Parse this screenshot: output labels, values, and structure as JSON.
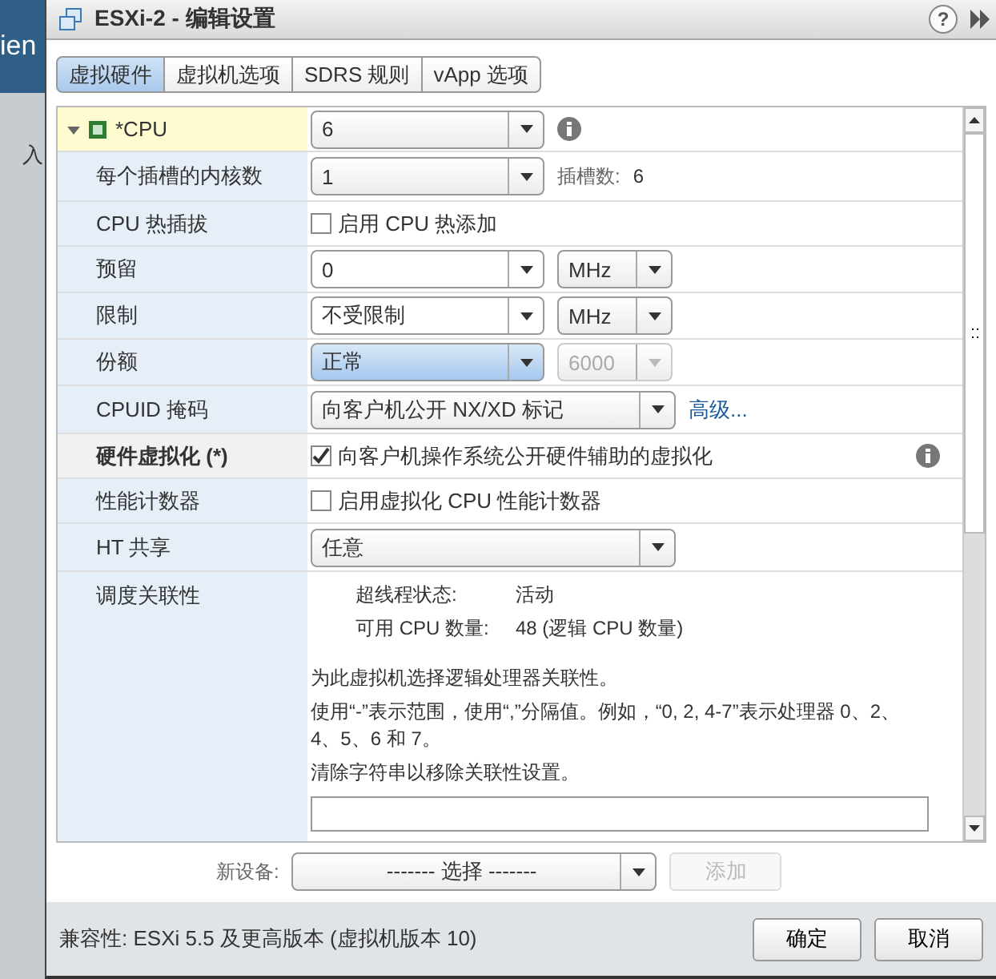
{
  "background_app": {
    "title_fragment": "ien",
    "tab_fragment": "入"
  },
  "window": {
    "title": "ESXi-2 - 编辑设置",
    "help": "?"
  },
  "tabs": [
    {
      "label": "虚拟硬件",
      "selected": true
    },
    {
      "label": "虚拟机选项",
      "selected": false
    },
    {
      "label": "SDRS 规则",
      "selected": false
    },
    {
      "label": "vApp 选项",
      "selected": false
    }
  ],
  "rows": [
    {
      "kind": "group",
      "label": "*CPU",
      "expanded": true,
      "value": "6"
    },
    {
      "kind": "select",
      "label": "每个插槽的内核数",
      "value": "1",
      "note_label": "插槽数:",
      "note_value": "6"
    },
    {
      "kind": "checkbox",
      "label": "CPU 热插拔",
      "checked": false,
      "text": "启用 CPU 热添加"
    },
    {
      "kind": "select_unit",
      "label": "预留",
      "value": "0",
      "focused": false,
      "unit": "MHz",
      "unit_disabled": false
    },
    {
      "kind": "select_unit",
      "label": "限制",
      "value": "不受限制",
      "focused": false,
      "unit": "MHz",
      "unit_disabled": false
    },
    {
      "kind": "select_unit",
      "label": "份额",
      "value": "正常",
      "focused": true,
      "unit": "6000",
      "unit_disabled": true
    },
    {
      "kind": "select_wide",
      "label": "CPUID 掩码",
      "value": "向客户机公开 NX/XD 标记",
      "link": "高级..."
    },
    {
      "kind": "checkbox_info",
      "label": "硬件虚拟化 (*)",
      "checked": true,
      "text": "向客户机操作系统公开硬件辅助的虚拟化"
    },
    {
      "kind": "checkbox",
      "label": "性能计数器",
      "checked": false,
      "text": "启用虚拟化 CPU 性能计数器"
    },
    {
      "kind": "select_plain",
      "label": "HT 共享",
      "value": "任意"
    },
    {
      "kind": "affinity",
      "label": "调度关联性",
      "facts": [
        {
          "label": "超线程状态:",
          "value": "活动"
        },
        {
          "label": "可用 CPU 数量:",
          "value": "48 (逻辑 CPU 数量)"
        }
      ],
      "lines": [
        "为此虚拟机选择逻辑处理器关联性。",
        "使用“-”表示范围，使用“,”分隔值。例如，“0, 2, 4-7”表示处理器 0、2、4、5、6 和 7。",
        "清除字符串以移除关联性设置。"
      ]
    }
  ],
  "new_device": {
    "label": "新设备:",
    "value": "------- 选择 -------",
    "button": "添加"
  },
  "footer": {
    "compatibility": "兼容性: ESXi 5.5 及更高版本 (虚拟机版本 10)",
    "buttons": [
      "确定",
      "取消"
    ]
  }
}
